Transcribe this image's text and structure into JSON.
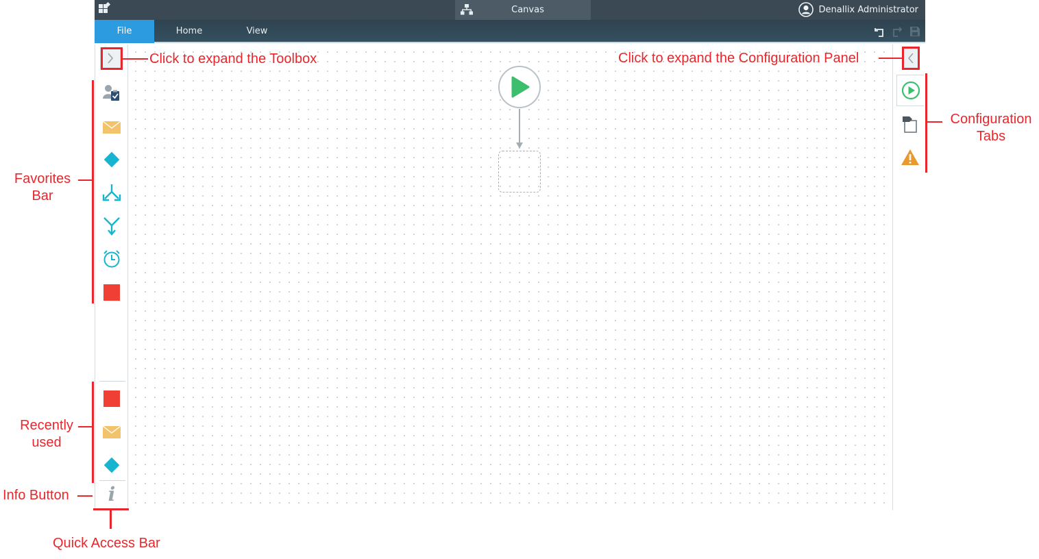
{
  "titlebar": {
    "tab_title": "Canvas",
    "user_name": "Denallix Administrator"
  },
  "ribbon": {
    "tabs": [
      {
        "label": "File",
        "active": true
      },
      {
        "label": "Home",
        "active": false
      },
      {
        "label": "View",
        "active": false
      }
    ]
  },
  "toolbox": {
    "favorites": [
      "task-icon",
      "email-icon",
      "decision-icon",
      "split-icon",
      "merge-icon",
      "timer-icon",
      "end-icon"
    ],
    "recent": [
      "end-icon",
      "email-icon",
      "decision-icon"
    ]
  },
  "config_tabs": [
    "start-icon",
    "reference-icon",
    "warning-icon"
  ],
  "colors": {
    "accent": "#2d9be0",
    "titlebar": "#3a4954",
    "callout": "#e8262b",
    "start": "#3cbf6d",
    "end": "#f03f35",
    "email": "#f2c36b",
    "teal": "#17b4cf",
    "warning": "#e99a2f"
  },
  "callouts": {
    "toolbox": "Click to expand the Toolbox",
    "config_panel": "Click to expand the Configuration Panel",
    "config_tabs": [
      "Configuration",
      "Tabs"
    ],
    "favorites": [
      "Favorites",
      "Bar"
    ],
    "recent": [
      "Recently",
      "used"
    ],
    "info": "Info Button",
    "quick_access": "Quick Access Bar"
  }
}
